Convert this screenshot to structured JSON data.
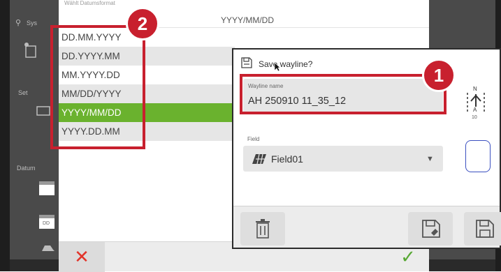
{
  "background_app": {
    "sidebar_texts": [
      "Sys",
      "Set",
      "Datum"
    ],
    "calendar_day_label": "DD"
  },
  "date_format_dialog": {
    "hint": "Wählt Datumsformat",
    "current_value": "YYYY/MM/DD",
    "options": [
      {
        "label": "DD.MM.YYYY"
      },
      {
        "label": "DD.YYYY.MM"
      },
      {
        "label": "MM.YYYY.DD"
      },
      {
        "label": "MM/DD/YYYY"
      },
      {
        "label": "YYYY/MM/DD",
        "selected": true
      },
      {
        "label": "YYYY.DD.MM"
      }
    ],
    "cancel_icon": "x-icon",
    "confirm_icon": "check-icon"
  },
  "save_dialog": {
    "title": "Save wayline?",
    "wayline_name_label": "Wayline name",
    "wayline_name_value": "AH 250910 11_35_12",
    "field_label": "Field",
    "field_value": "Field01",
    "north_letter": "N",
    "a_letter": "A",
    "scale_text": "10"
  },
  "annotations": {
    "badge_1": "1",
    "badge_2": "2",
    "highlight_color": "#c8202e"
  },
  "colors": {
    "selected_row": "#6ab22e",
    "cancel": "#e2342a",
    "confirm": "#57a833"
  }
}
